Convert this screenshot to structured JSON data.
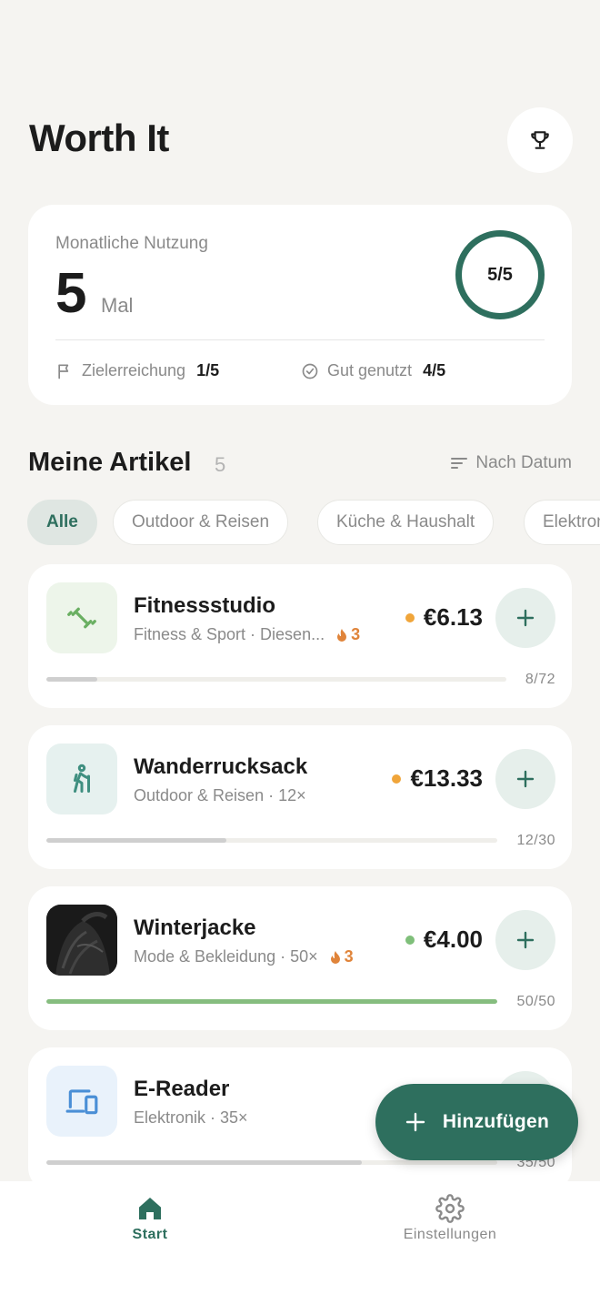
{
  "app": {
    "title": "Worth It"
  },
  "summary": {
    "label": "Monatliche Nutzung",
    "value": "5",
    "unit": "Mal",
    "ring_text": "5/5",
    "goal_label": "Zielerreichung",
    "goal_value": "1/5",
    "good_label": "Gut genutzt",
    "good_value": "4/5"
  },
  "section": {
    "title": "Meine Artikel",
    "count": "5",
    "sort_label": "Nach Datum"
  },
  "chips": [
    {
      "label": "Alle",
      "active": true
    },
    {
      "label": "Outdoor & Reisen",
      "active": false
    },
    {
      "label": "Küche & Haushalt",
      "active": false
    },
    {
      "label": "Elektronik",
      "active": false
    }
  ],
  "items": [
    {
      "name": "Fitnessstudio",
      "subtitle": "Fitness & Sport · Diesen...",
      "streak": "3",
      "price": "€6.13",
      "dot_color": "#f0a53a",
      "count": "8/72",
      "progress": 0.11,
      "icon": "dumbbell-icon"
    },
    {
      "name": "Wanderrucksack",
      "subtitle": "Outdoor & Reisen · 12×",
      "streak": "",
      "price": "€13.33",
      "dot_color": "#f0a53a",
      "count": "12/30",
      "progress": 0.4,
      "icon": "hiker-icon"
    },
    {
      "name": "Winterjacke",
      "subtitle": "Mode & Bekleidung · 50×",
      "streak": "3",
      "price": "€4.00",
      "dot_color": "#7fbf7a",
      "count": "50/50",
      "progress": 1.0,
      "icon": "jacket-photo"
    },
    {
      "name": "E-Reader",
      "subtitle": "Elektronik · 35×",
      "streak": "",
      "price": "",
      "dot_color": "",
      "count": "35/50",
      "progress": 0.7,
      "icon": "devices-icon"
    }
  ],
  "fab": {
    "label": "Hinzufügen"
  },
  "nav": {
    "home_label": "Start",
    "settings_label": "Einstellungen"
  },
  "colors": {
    "accent": "#2e6f5e",
    "background": "#f5f4f1",
    "orange": "#e0843a"
  }
}
